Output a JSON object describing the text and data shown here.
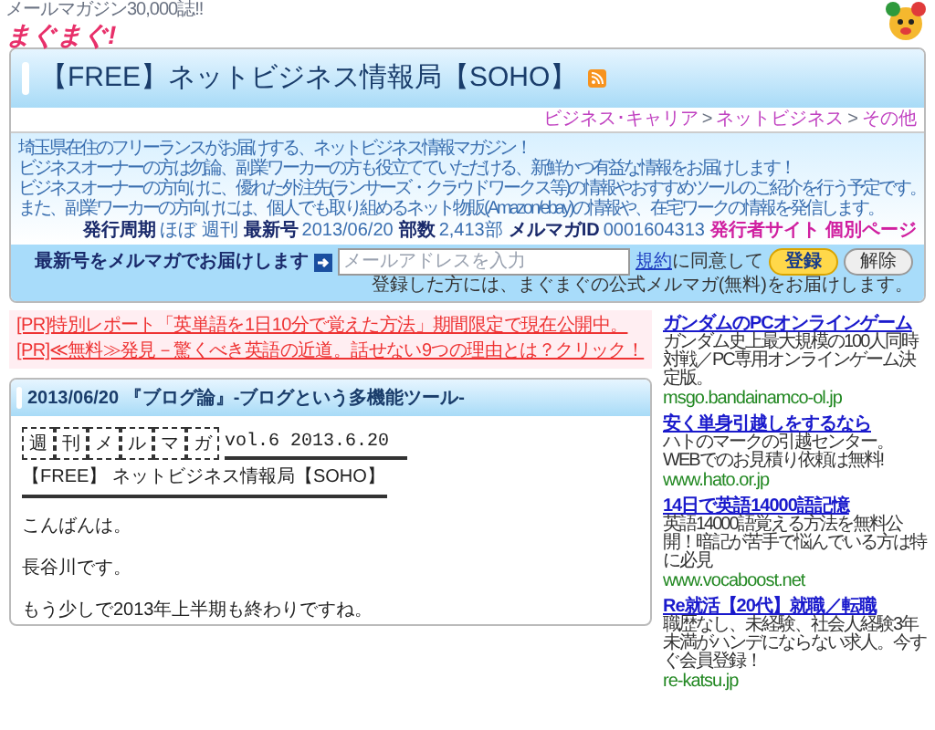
{
  "header": {
    "tagline": "メールマガジン30,000誌!!",
    "logo": "まぐまぐ!"
  },
  "magazine": {
    "title": "【FREE】ネットビジネス情報局【SOHO】",
    "breadcrumb": [
      "ビジネス･キャリア",
      "ネットビジネス",
      "その他"
    ],
    "breadcrumb_separator": ">",
    "description": [
      "埼玉県在住のフリーランスがお届けする、ネットビジネス情報マガジン！",
      "ビジネスオーナーの方は勿論、副業ワーカーの方も役立てていただける、新鮮かつ有益な情報をお届けします！",
      "ビジネスオーナーの方向けに、優れた外注先(ランサーズ・クラウドワークス等)の情報やおすすめツールのご紹介を行う予定です。",
      "また、副業ワーカーの方向けには、個人でも取り組めるネット物販(Amazon/ebay)の情報や、在宅ワークの情報を発信します。"
    ],
    "stats": [
      {
        "label": "発行周期",
        "value": "ほぼ 週刊"
      },
      {
        "label": "最新号",
        "value": "2013/06/20"
      },
      {
        "label": "部数",
        "value": "2,413部"
      },
      {
        "label": "メルマガID",
        "value": "0001604313"
      }
    ],
    "links": [
      "発行者サイト",
      "個別ページ"
    ],
    "subscribe": {
      "label": "最新号をメルマガでお届けします",
      "placeholder": "メールアドレスを入力",
      "terms_link": "規約",
      "terms_text": "に同意して",
      "register_button": "登録",
      "unsubscribe_button": "解除",
      "note": "登録した方には、まぐまぐの公式メルマガ(無料)をお届けします。"
    }
  },
  "pr_links": [
    "[PR]特別レポート「英単語を1日10分で覚えた方法」期間限定で現在公開中。",
    "[PR]≪無料≫発見－驚くべき英語の近道。話せない9つの理由とは？クリック！"
  ],
  "article": {
    "title": "2013/06/20 『ブログ論』-ブログという多機能ツール-",
    "banner": [
      "週",
      "刊",
      "メ",
      "ル",
      "マ",
      "ガ"
    ],
    "issue": "vol.6 2013.6.20",
    "masthead": "【FREE】 ネットビジネス情報局【SOHO】",
    "paragraphs": [
      "こんばんは。",
      "長谷川です。",
      "もう少しで2013年上半期も終わりですね。"
    ]
  },
  "ads": [
    {
      "title": "ガンダムのPCオンラインゲーム",
      "body": "ガンダム史上最大規模の100人同時対戦／PC専用オンラインゲーム決定版。",
      "url": "msgo.bandainamco-ol.jp"
    },
    {
      "title": "安く単身引越しをするなら",
      "body": "ハトのマークの引越センター。WEBでのお見積り依頼は無料!",
      "url": "www.hato.or.jp"
    },
    {
      "title": "14日で英語14000語記憶",
      "body": "英語14000語覚える方法を無料公開！暗記が苦手で悩んでいる方は特に必見",
      "url": "www.vocaboost.net"
    },
    {
      "title": "Re就活【20代】就職／転職",
      "body": "職歴なし、未経験、社会人経験3年未満がハンデにならない求人。今すぐ会員登録！",
      "url": "re-katsu.jp"
    }
  ]
}
